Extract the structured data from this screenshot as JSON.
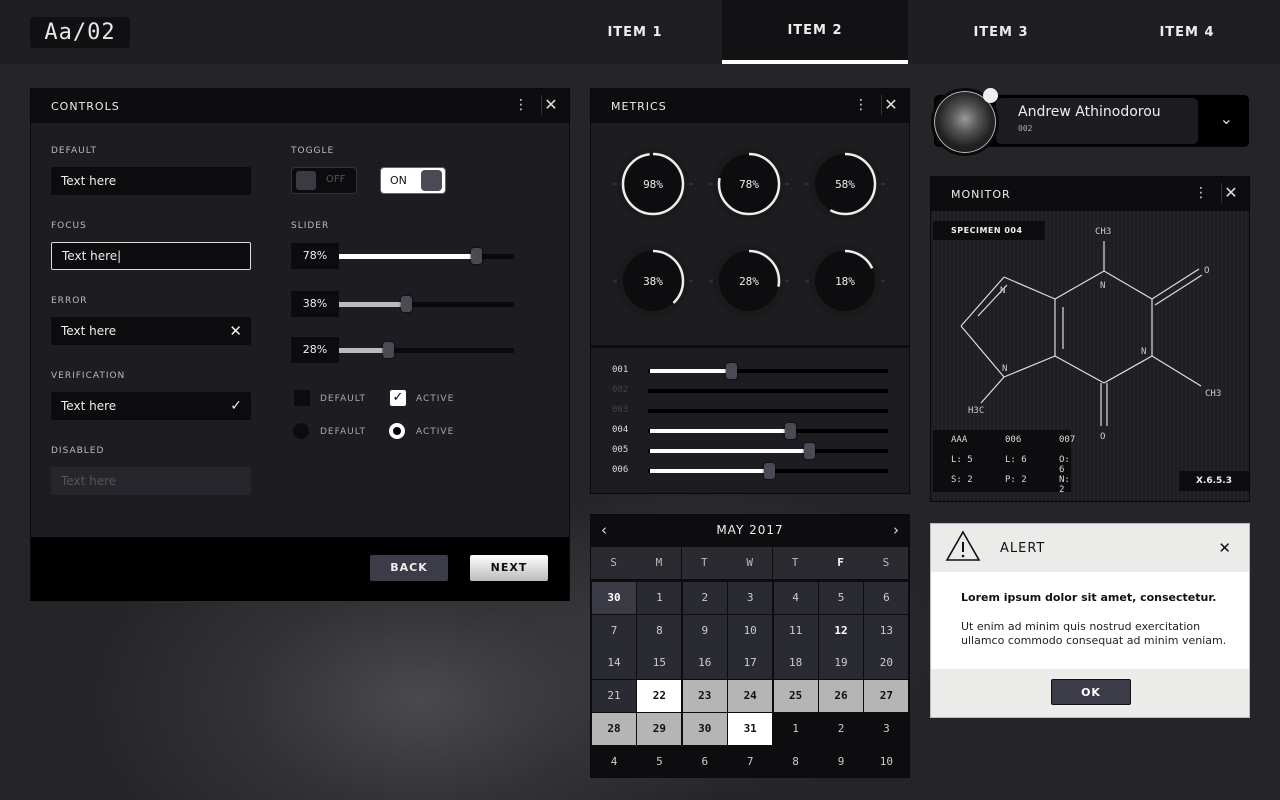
{
  "header": {
    "logo": "Aa/02",
    "nav": [
      {
        "label": "ITEM 1"
      },
      {
        "label": "ITEM 2",
        "active": true
      },
      {
        "label": "ITEM 3"
      },
      {
        "label": "ITEM 4"
      }
    ]
  },
  "controls": {
    "title": "CONTROLS",
    "fields": [
      {
        "label": "DEFAULT",
        "value": "Text here"
      },
      {
        "label": "FOCUS",
        "value": "Text here|"
      },
      {
        "label": "ERROR",
        "value": "Text here",
        "icon": "close-icon"
      },
      {
        "label": "VERIFICATION",
        "value": "Text here",
        "icon": "check-icon"
      },
      {
        "label": "DISABLED",
        "placeholder": "Text here"
      }
    ],
    "toggle_label": "TOGGLE",
    "toggle_off": "OFF",
    "toggle_on": "ON",
    "slider_label": "SLIDER",
    "sliders": [
      {
        "text": "78%",
        "value": 78
      },
      {
        "text": "38%",
        "value": 38
      },
      {
        "text": "28%",
        "value": 28
      }
    ],
    "checkbox_default": "DEFAULT",
    "checkbox_active": "ACTIVE",
    "radio_default": "DEFAULT",
    "radio_active": "ACTIVE",
    "back": "BACK",
    "next": "NEXT"
  },
  "metrics": {
    "title": "METRICS",
    "gauges": [
      {
        "text": "98%",
        "value": 98
      },
      {
        "text": "78%",
        "value": 78
      },
      {
        "text": "58%",
        "value": 58
      },
      {
        "text": "38%",
        "value": 38
      },
      {
        "text": "28%",
        "value": 28
      },
      {
        "text": "18%",
        "value": 18
      }
    ],
    "sliders": [
      {
        "label": "001",
        "value": 34
      },
      {
        "label": "002",
        "value": 0,
        "disabled": true
      },
      {
        "label": "003",
        "value": 0,
        "disabled": true
      },
      {
        "label": "004",
        "value": 59
      },
      {
        "label": "005",
        "value": 67
      },
      {
        "label": "006",
        "value": 50
      }
    ]
  },
  "calendar": {
    "title": "MAY 2017",
    "weekdays": [
      "S",
      "M",
      "T",
      "W",
      "T",
      "F",
      "S"
    ],
    "days": [
      [
        {
          "d": "30",
          "s": "prev"
        },
        {
          "d": "1"
        },
        {
          "d": "2"
        },
        {
          "d": "3"
        },
        {
          "d": "4"
        },
        {
          "d": "5"
        },
        {
          "d": "6"
        }
      ],
      [
        {
          "d": "7"
        },
        {
          "d": "8"
        },
        {
          "d": "9"
        },
        {
          "d": "10"
        },
        {
          "d": "11"
        },
        {
          "d": "12",
          "s": "bold"
        },
        {
          "d": "13"
        }
      ],
      [
        {
          "d": "14"
        },
        {
          "d": "15"
        },
        {
          "d": "16"
        },
        {
          "d": "17"
        },
        {
          "d": "18"
        },
        {
          "d": "19"
        },
        {
          "d": "20"
        }
      ],
      [
        {
          "d": "21"
        },
        {
          "d": "22",
          "s": "sel"
        },
        {
          "d": "23",
          "s": "range"
        },
        {
          "d": "24",
          "s": "range"
        },
        {
          "d": "25",
          "s": "range"
        },
        {
          "d": "26",
          "s": "range"
        },
        {
          "d": "27",
          "s": "range"
        }
      ],
      [
        {
          "d": "28",
          "s": "range"
        },
        {
          "d": "29",
          "s": "range"
        },
        {
          "d": "30",
          "s": "range"
        },
        {
          "d": "31",
          "s": "sel"
        },
        {
          "d": "1",
          "s": "next"
        },
        {
          "d": "2",
          "s": "next"
        },
        {
          "d": "3",
          "s": "next"
        }
      ],
      [
        {
          "d": "4",
          "s": "next"
        },
        {
          "d": "5",
          "s": "next"
        },
        {
          "d": "6",
          "s": "next"
        },
        {
          "d": "7",
          "s": "next"
        },
        {
          "d": "8",
          "s": "next"
        },
        {
          "d": "9",
          "s": "next"
        },
        {
          "d": "10",
          "s": "next"
        }
      ]
    ]
  },
  "profile": {
    "name": "Andrew Athinodorou",
    "id": "002"
  },
  "monitor": {
    "title": "MONITOR",
    "specimen": "SPECIMEN 004",
    "atoms": {
      "ch3_top": "CH3",
      "o_right": "O",
      "n1": "N",
      "n2": "N",
      "n3": "N",
      "n4": "N",
      "ch3_right": "CH3",
      "h3c": "H3C",
      "o_bottom": "O"
    },
    "table": [
      [
        "AAA",
        "006",
        "007"
      ],
      [
        "L: 5",
        "L: 6",
        "O: 6"
      ],
      [
        "S: 2",
        "P: 2",
        "N: 2"
      ]
    ],
    "version": "X.6.5.3"
  },
  "alert": {
    "title": "ALERT",
    "heading": "Lorem ipsum dolor sit amet, consectetur.",
    "body": "Ut enim ad minim quis nostrud exercitation ullamco commodo consequat ad minim veniam.",
    "ok": "OK"
  }
}
